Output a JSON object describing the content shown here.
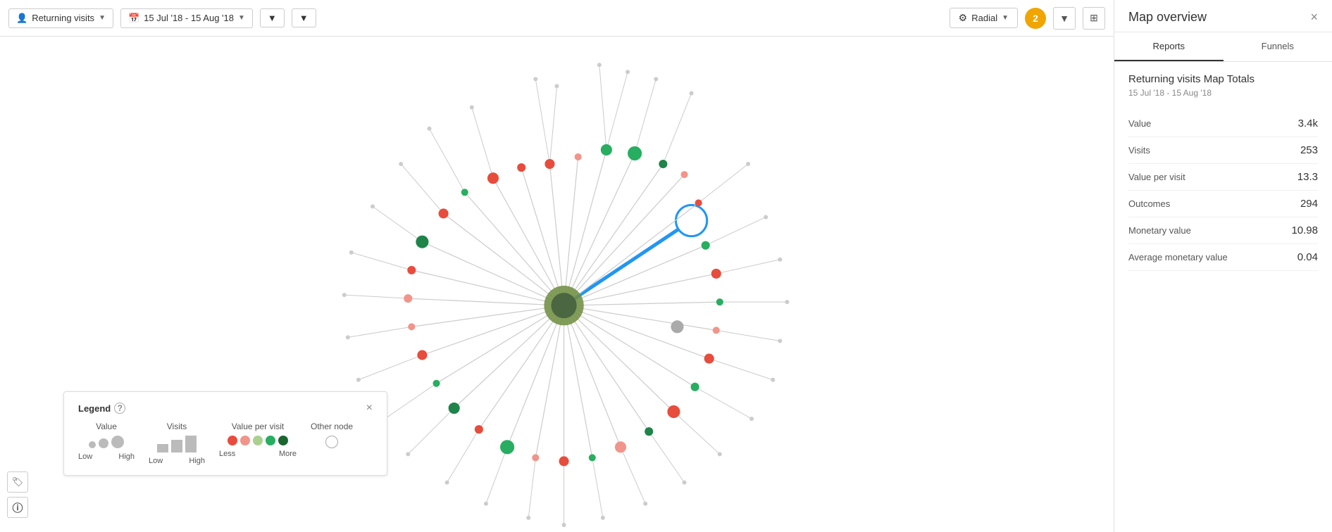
{
  "toolbar": {
    "segment_label": "Returning visits",
    "date_range": "15 Jul '18 - 15 Aug '18",
    "filter_label": "Filter",
    "radial_label": "Radial",
    "badge_count": "2",
    "layout_icon": "⊞"
  },
  "panel": {
    "title": "Map overview",
    "close_icon": "×",
    "tabs": [
      {
        "label": "Reports",
        "active": true
      },
      {
        "label": "Funnels",
        "active": false
      }
    ],
    "section_title": "Returning visits Map Totals",
    "date_range": "15 Jul '18 - 15 Aug '18",
    "stats": [
      {
        "label": "Value",
        "value": "3.4k"
      },
      {
        "label": "Visits",
        "value": "253"
      },
      {
        "label": "Value per visit",
        "value": "13.3"
      },
      {
        "label": "Outcomes",
        "value": "294"
      },
      {
        "label": "Monetary value",
        "value": "10.98"
      },
      {
        "label": "Average monetary value",
        "value": "0.04"
      }
    ]
  },
  "legend": {
    "title": "Legend",
    "close_icon": "×",
    "value_label": "Value",
    "visits_label": "Visits",
    "value_per_visit_label": "Value per visit",
    "other_node_label": "Other node",
    "low_label": "Low",
    "high_label": "High",
    "less_label": "Less",
    "more_label": "More"
  },
  "bottom_icons": [
    {
      "icon": "🏷",
      "name": "tag-icon"
    },
    {
      "icon": "ⓘ",
      "name": "info-icon"
    }
  ]
}
